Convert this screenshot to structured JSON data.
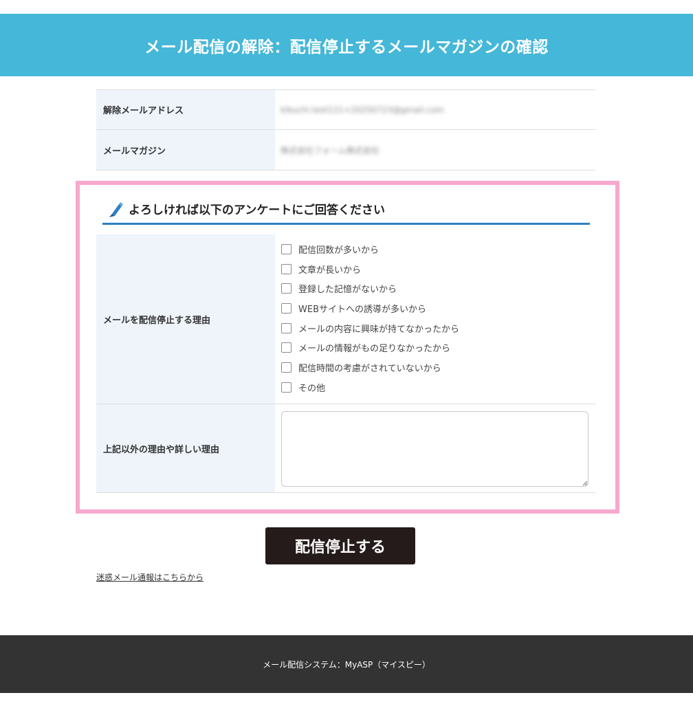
{
  "header": {
    "title": "メール配信の解除：配信停止するメールマガジンの確認"
  },
  "info": {
    "rows": [
      {
        "label": "解除メールアドレス",
        "value": "kikuchi.test121+20250723@gmail.com"
      },
      {
        "label": "メールマガジン",
        "value": "株式会社フォーム株式会社"
      }
    ]
  },
  "survey": {
    "heading": "よろしければ以下のアンケートにご回答ください",
    "reason_label": "メールを配信停止する理由",
    "options": [
      "配信回数が多いから",
      "文章が長いから",
      "登録した記憶がないから",
      "WEBサイトへの誘導が多いから",
      "メールの内容に興味が持てなかったから",
      "メールの情報がもの足りなかったから",
      "配信時間の考慮がされていないから",
      "その他"
    ],
    "detail_label": "上記以外の理由や詳しい理由",
    "detail_value": ""
  },
  "submit": {
    "label": "配信停止する"
  },
  "report_link": {
    "label": "迷惑メール通報はこちらから"
  },
  "footer": {
    "text": "メール配信システム：MyASP（マイスピー）"
  },
  "colors": {
    "header_bg": "#45b7d8",
    "survey_border": "#f7a8cd",
    "heading_rule": "#2f7fc1",
    "label_bg": "#eef4fa",
    "button_bg": "#251b1a",
    "footer_bg": "#333333"
  }
}
